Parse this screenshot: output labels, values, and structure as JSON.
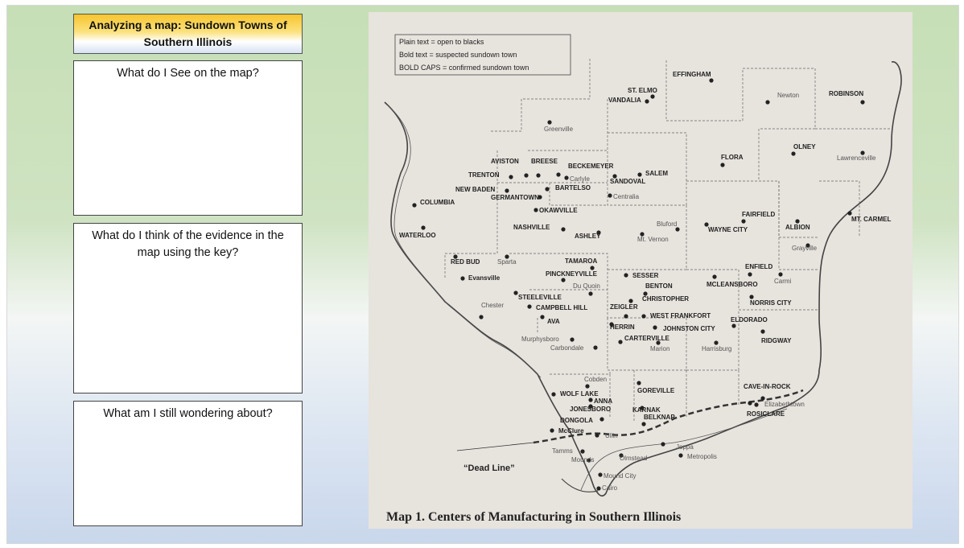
{
  "title": {
    "line1": "Analyzing a map: Sundown Towns of",
    "line2": "Southern Illinois"
  },
  "questions": [
    "What do I See on the map?",
    "What do I think of the evidence in the map using the key?",
    "What am I still wondering about?"
  ],
  "map": {
    "legend": [
      "Plain text = open to blacks",
      "Bold text = suspected sundown town",
      "BOLD CAPS = confirmed sundown town"
    ],
    "caption": "Map 1. Centers of Manufacturing in Southern Illinois",
    "dead_line_label": "“Dead Line”",
    "towns": [
      {
        "name": "EFFINGHAM",
        "style": "b"
      },
      {
        "name": "ST. ELMO",
        "style": "b"
      },
      {
        "name": "VANDALIA",
        "style": "b"
      },
      {
        "name": "Newton",
        "style": "p"
      },
      {
        "name": "ROBINSON",
        "style": "b"
      },
      {
        "name": "Greenville",
        "style": "p"
      },
      {
        "name": "OLNEY",
        "style": "b"
      },
      {
        "name": "FLORA",
        "style": "b"
      },
      {
        "name": "Lawrenceville",
        "style": "p"
      },
      {
        "name": "AVISTON",
        "style": "b"
      },
      {
        "name": "BREESE",
        "style": "b"
      },
      {
        "name": "BECKEMEYER",
        "style": "b"
      },
      {
        "name": "TRENTON",
        "style": "b"
      },
      {
        "name": "Carlyle",
        "style": "p"
      },
      {
        "name": "SALEM",
        "style": "b"
      },
      {
        "name": "SANDOVAL",
        "style": "b"
      },
      {
        "name": "NEW BADEN",
        "style": "b"
      },
      {
        "name": "BARTELSO",
        "style": "b"
      },
      {
        "name": "GERMANTOWN",
        "style": "b"
      },
      {
        "name": "Centralia",
        "style": "p"
      },
      {
        "name": "COLUMBIA",
        "style": "b"
      },
      {
        "name": "OKAWVILLE",
        "style": "b"
      },
      {
        "name": "FAIRFIELD",
        "style": "b"
      },
      {
        "name": "MT. CARMEL",
        "style": "b"
      },
      {
        "name": "Bluford",
        "style": "p"
      },
      {
        "name": "NASHVILLE",
        "style": "b"
      },
      {
        "name": "WAYNE CITY",
        "style": "b"
      },
      {
        "name": "ALBION",
        "style": "b"
      },
      {
        "name": "WATERLOO",
        "style": "b"
      },
      {
        "name": "ASHLEY",
        "style": "b"
      },
      {
        "name": "Mt. Vernon",
        "style": "p"
      },
      {
        "name": "Grayville",
        "style": "p"
      },
      {
        "name": "RED BUD",
        "style": "b"
      },
      {
        "name": "Sparta",
        "style": "p"
      },
      {
        "name": "TAMAROA",
        "style": "b"
      },
      {
        "name": "ENFIELD",
        "style": "b"
      },
      {
        "name": "Evansville",
        "style": "b"
      },
      {
        "name": "PINCKNEYVILLE",
        "style": "b"
      },
      {
        "name": "SESSER",
        "style": "b"
      },
      {
        "name": "Carmi",
        "style": "p"
      },
      {
        "name": "Du Quoin",
        "style": "p"
      },
      {
        "name": "BENTON",
        "style": "b"
      },
      {
        "name": "MCLEANSBORO",
        "style": "b"
      },
      {
        "name": "STEELEVILLE",
        "style": "b"
      },
      {
        "name": "CHRISTOPHER",
        "style": "b"
      },
      {
        "name": "NORRIS CITY",
        "style": "b"
      },
      {
        "name": "Chester",
        "style": "p"
      },
      {
        "name": "CAMPBELL HILL",
        "style": "b"
      },
      {
        "name": "ZEIGLER",
        "style": "b"
      },
      {
        "name": "WEST FRANKFORT",
        "style": "b"
      },
      {
        "name": "AVA",
        "style": "b"
      },
      {
        "name": "ELDORADO",
        "style": "b"
      },
      {
        "name": "HERRIN",
        "style": "b"
      },
      {
        "name": "JOHNSTON CITY",
        "style": "b"
      },
      {
        "name": "Murphysboro",
        "style": "p"
      },
      {
        "name": "CARTERVILLE",
        "style": "b"
      },
      {
        "name": "RIDGWAY",
        "style": "b"
      },
      {
        "name": "Carbondale",
        "style": "p"
      },
      {
        "name": "Marion",
        "style": "p"
      },
      {
        "name": "Harrisburg",
        "style": "p"
      },
      {
        "name": "Cobden",
        "style": "p"
      },
      {
        "name": "GOREVILLE",
        "style": "b"
      },
      {
        "name": "CAVE-IN-ROCK",
        "style": "b"
      },
      {
        "name": "WOLF LAKE",
        "style": "b"
      },
      {
        "name": "ANNA",
        "style": "b"
      },
      {
        "name": "Elizabethtown",
        "style": "p"
      },
      {
        "name": "JONESBORO",
        "style": "b"
      },
      {
        "name": "ROSICLARE",
        "style": "b"
      },
      {
        "name": "KARNAK",
        "style": "b"
      },
      {
        "name": "BELKNAP",
        "style": "b"
      },
      {
        "name": "DONGOLA",
        "style": "b"
      },
      {
        "name": "McClure",
        "style": "b"
      },
      {
        "name": "Ullin",
        "style": "p"
      },
      {
        "name": "Joppa",
        "style": "p"
      },
      {
        "name": "Tamms",
        "style": "p"
      },
      {
        "name": "Mounds",
        "style": "p"
      },
      {
        "name": "Olmstead",
        "style": "p"
      },
      {
        "name": "Metropolis",
        "style": "p"
      },
      {
        "name": "Mound City",
        "style": "p"
      },
      {
        "name": "Cairo",
        "style": "p"
      }
    ]
  }
}
